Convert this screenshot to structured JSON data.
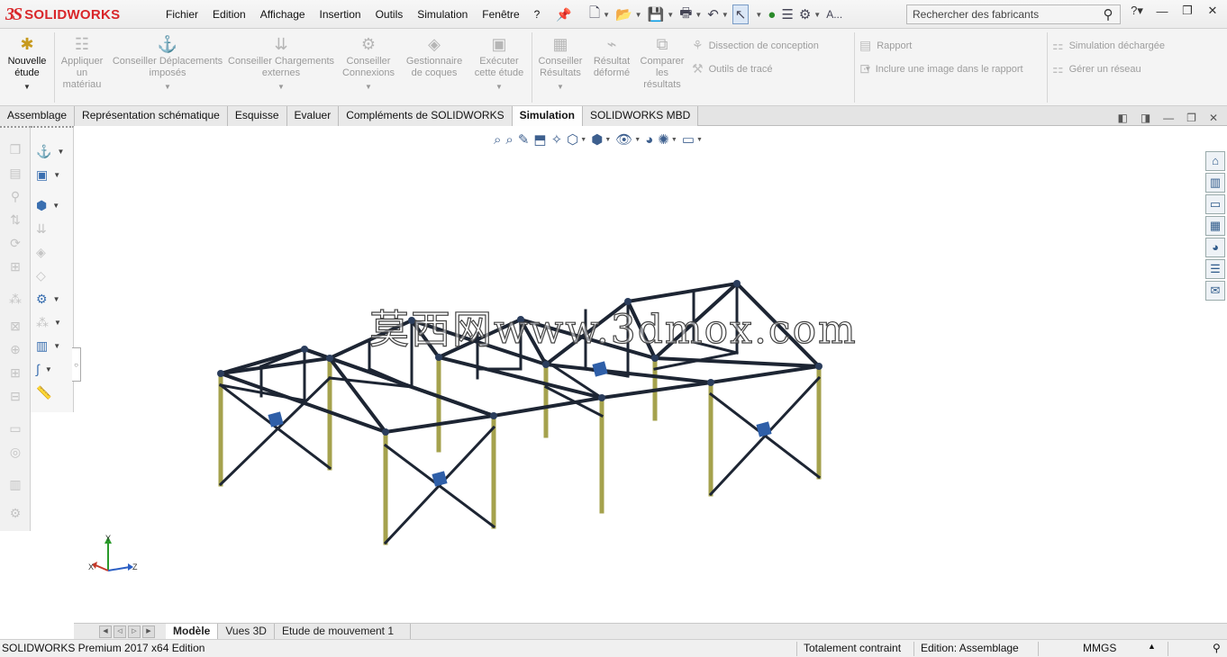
{
  "app": {
    "logo_ds": "3S",
    "logo_name": "SOLIDWORKS"
  },
  "menu": [
    "Fichier",
    "Edition",
    "Affichage",
    "Insertion",
    "Outils",
    "Simulation",
    "Fenêtre",
    "?"
  ],
  "quick_toolbar": {
    "cursor_label": "A...",
    "search_placeholder": "Rechercher des fabricants"
  },
  "ribbon": {
    "new_study": "Nouvelle étude",
    "apply_material": "Appliquer un matériau",
    "advise_fixtures": "Conseiller Déplacements imposés",
    "advise_loads": "Conseiller Chargements externes",
    "advise_connections": "Conseiller Connexions",
    "shell_manager": "Gestionnaire de coques",
    "run_study": "Exécuter cette étude",
    "advise_results": "Conseiller Résultats",
    "deformed_result": "Résultat déformé",
    "compare_results": "Comparer les résultats",
    "design_insight": "Dissection de conception",
    "plot_tools": "Outils de tracé",
    "report": "Rapport",
    "include_image": "Inclure une image dans le rapport",
    "offloaded_simulation": "Simulation déchargée",
    "manage_network": "Gérer un réseau"
  },
  "tabs": [
    {
      "label": "Assemblage",
      "active": false
    },
    {
      "label": "Représentation schématique",
      "active": false
    },
    {
      "label": "Esquisse",
      "active": false
    },
    {
      "label": "Evaluer",
      "active": false
    },
    {
      "label": "Compléments de SOLIDWORKS",
      "active": false
    },
    {
      "label": "Simulation",
      "active": true
    },
    {
      "label": "SOLIDWORKS MBD",
      "active": false
    }
  ],
  "watermark": "莫西网www.3dmox.com",
  "triad": {
    "x": "X",
    "y": "Y",
    "z": "Z"
  },
  "bottom_tabs": [
    {
      "label": "Modèle",
      "active": true
    },
    {
      "label": "Vues 3D",
      "active": false
    },
    {
      "label": "Etude de mouvement 1",
      "active": false
    }
  ],
  "status": {
    "product": "SOLIDWORKS Premium 2017 x64 Edition",
    "constraint": "Totalement contraint",
    "editing": "Edition: Assemblage",
    "units": "MMGS"
  },
  "colors": {
    "brand": "#d9262a",
    "beam": "#1d2533",
    "column": "#a5a24d",
    "plate": "#2f5fa8"
  }
}
